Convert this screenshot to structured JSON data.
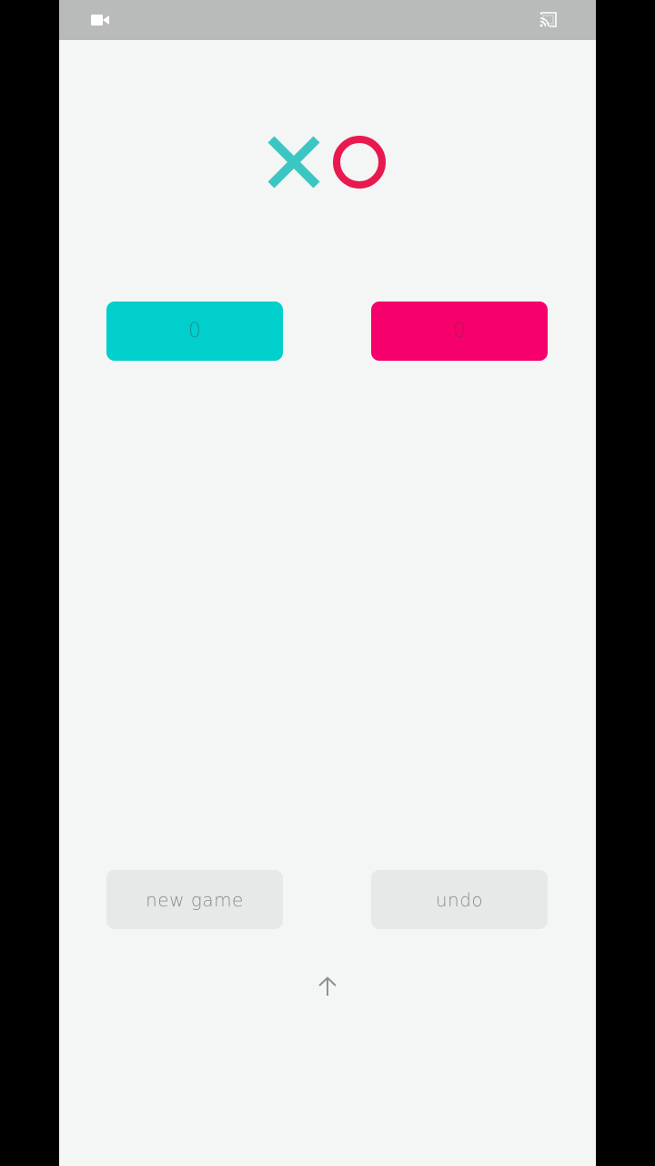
{
  "status_bar": {
    "left_icon": "camera-icon",
    "right_icon": "cast-icon",
    "background": "#b9bbba"
  },
  "logo": {
    "x_color": "#3cc6c3",
    "o_color": "#e8194f"
  },
  "scores": {
    "x": {
      "value": "0",
      "color": "#00cfcc"
    },
    "o": {
      "value": "0",
      "color": "#f6006c"
    }
  },
  "actions": {
    "new_game_label": "new game",
    "undo_label": "undo"
  },
  "footer": {
    "icon": "arrow-up-icon"
  }
}
